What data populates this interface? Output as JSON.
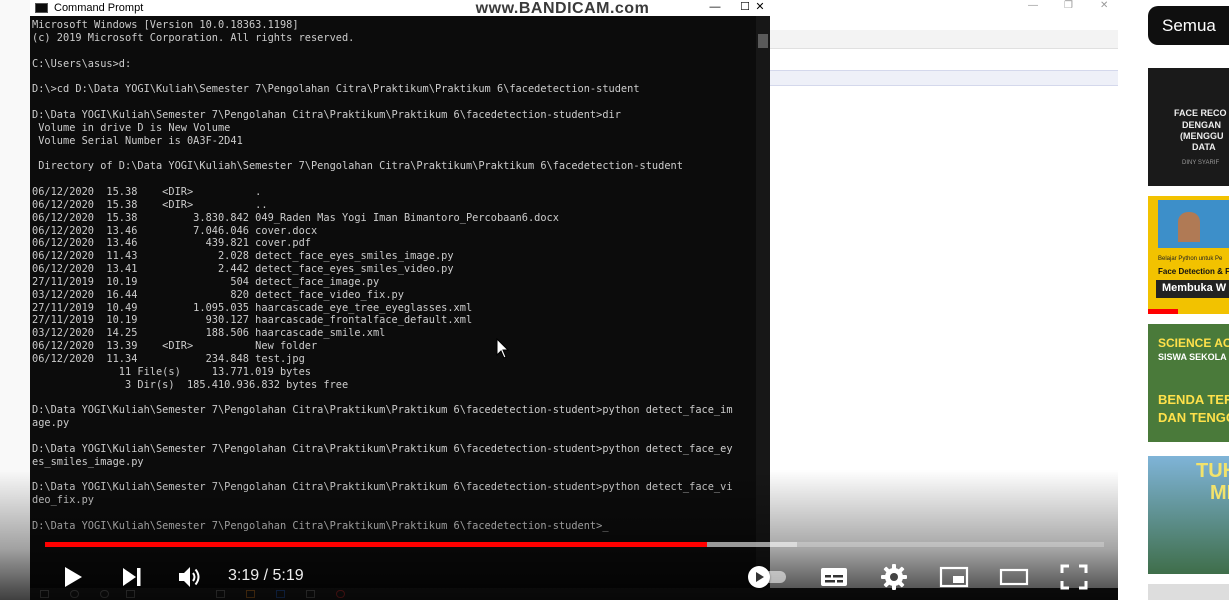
{
  "cmd": {
    "title": "Command Prompt",
    "lines": [
      "Microsoft Windows [Version 10.0.18363.1198]",
      "(c) 2019 Microsoft Corporation. All rights reserved.",
      "",
      "C:\\Users\\asus>d:",
      "",
      "D:\\>cd D:\\Data YOGI\\Kuliah\\Semester 7\\Pengolahan Citra\\Praktikum\\Praktikum 6\\facedetection-student",
      "",
      "D:\\Data YOGI\\Kuliah\\Semester 7\\Pengolahan Citra\\Praktikum\\Praktikum 6\\facedetection-student>dir",
      " Volume in drive D is New Volume",
      " Volume Serial Number is 0A3F-2D41",
      "",
      " Directory of D:\\Data YOGI\\Kuliah\\Semester 7\\Pengolahan Citra\\Praktikum\\Praktikum 6\\facedetection-student",
      "",
      "06/12/2020  15.38    <DIR>          .",
      "06/12/2020  15.38    <DIR>          ..",
      "06/12/2020  15.38         3.830.842 049_Raden Mas Yogi Iman Bimantoro_Percobaan6.docx",
      "06/12/2020  13.46         7.046.046 cover.docx",
      "06/12/2020  13.46           439.821 cover.pdf",
      "06/12/2020  11.43             2.028 detect_face_eyes_smiles_image.py",
      "06/12/2020  13.41             2.442 detect_face_eyes_smiles_video.py",
      "27/11/2019  10.19               504 detect_face_image.py",
      "03/12/2020  16.44               820 detect_face_video_fix.py",
      "27/11/2019  10.49         1.095.035 haarcascade_eye_tree_eyeglasses.xml",
      "27/11/2019  10.19           930.127 haarcascade_frontalface_default.xml",
      "03/12/2020  14.25           188.506 haarcascade_smile.xml",
      "06/12/2020  13.39    <DIR>          New folder",
      "06/12/2020  11.34           234.848 test.jpg",
      "              11 File(s)     13.771.019 bytes",
      "               3 Dir(s)  185.410.936.832 bytes free",
      "",
      "D:\\Data YOGI\\Kuliah\\Semester 7\\Pengolahan Citra\\Praktikum\\Praktikum 6\\facedetection-student>python detect_face_im",
      "age.py",
      "",
      "D:\\Data YOGI\\Kuliah\\Semester 7\\Pengolahan Citra\\Praktikum\\Praktikum 6\\facedetection-student>python detect_face_ey",
      "es_smiles_image.py",
      "",
      "D:\\Data YOGI\\Kuliah\\Semester 7\\Pengolahan Citra\\Praktikum\\Praktikum 6\\facedetection-student>python detect_face_vi",
      "deo_fix.py",
      "",
      "D:\\Data YOGI\\Kuliah\\Semester 7\\Pengolahan Citra\\Praktikum\\Praktikum 6\\facedetection-student>_"
    ]
  },
  "watermark": "www.BANDICAM.com",
  "player": {
    "current_time": "3:19",
    "separator": "/",
    "duration": "5:19",
    "progress_played_fraction": 0.625,
    "progress_loaded_fraction": 0.71,
    "icons": {
      "play": "play-icon",
      "next": "next-icon",
      "volume": "volume-icon",
      "autoplay": "autoplay-toggle",
      "subtitles": "subtitles-icon",
      "settings": "gear-icon",
      "miniplayer": "miniplayer-icon",
      "theater": "theater-mode-icon",
      "fullscreen": "fullscreen-icon"
    }
  },
  "sidebar": {
    "chip_label": "Semua",
    "thumbs": [
      {
        "lines": [
          "FACE RECO",
          "DENGAN",
          "(MENGGU",
          "DATA",
          "DINY SYARIF"
        ]
      },
      {
        "lines": [
          "Belajar Python untuk Pe",
          "Face Detection & Face Re",
          "Membuka W"
        ]
      },
      {
        "lines": [
          "SCIENCE AC",
          "SISWA SEKOLA",
          "BENDA TER",
          "DAN TENGG"
        ]
      },
      {
        "lines": [
          "TUH",
          "MER"
        ]
      }
    ]
  },
  "colors": {
    "progress_played": "#ff0000",
    "terminal_bg": "#0c0c0c",
    "terminal_text": "#cccccc",
    "chip_bg": "#0f0f0f"
  }
}
